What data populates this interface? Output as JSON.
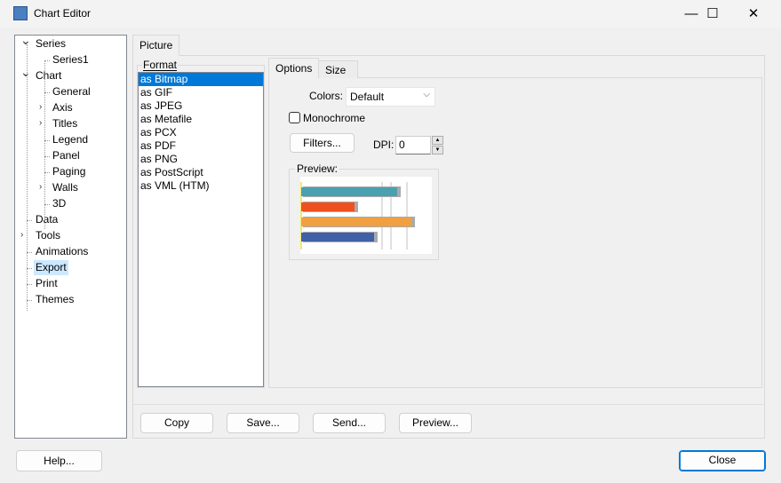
{
  "window": {
    "title": "Chart Editor",
    "minimize": "—",
    "maximize": "☐",
    "close": "✕"
  },
  "tree": [
    {
      "label": "Series",
      "expanded": true
    },
    {
      "label": "Series1"
    },
    {
      "label": "Chart",
      "expanded": true
    },
    {
      "label": "General"
    },
    {
      "label": "Axis",
      "collapsed": true
    },
    {
      "label": "Titles",
      "collapsed": true
    },
    {
      "label": "Legend"
    },
    {
      "label": "Panel"
    },
    {
      "label": "Paging"
    },
    {
      "label": "Walls",
      "collapsed": true
    },
    {
      "label": "3D"
    },
    {
      "label": "Data"
    },
    {
      "label": "Tools",
      "collapsed": true
    },
    {
      "label": "Animations"
    },
    {
      "label": "Export",
      "selected": true
    },
    {
      "label": "Print"
    },
    {
      "label": "Themes"
    }
  ],
  "tabs": {
    "picture": "Picture",
    "options": "Options",
    "size": "Size"
  },
  "format": {
    "label": "Format",
    "items": [
      "as Bitmap",
      "as GIF",
      "as JPEG",
      "as Metafile",
      "as PCX",
      "as PDF",
      "as PNG",
      "as PostScript",
      "as VML (HTM)"
    ],
    "selected": "as Bitmap"
  },
  "options": {
    "colors_label": "Colors:",
    "colors_value": "Default",
    "monochrome_label": "Monochrome",
    "monochrome_checked": false,
    "filters_button": "Filters...",
    "dpi_label": "DPI:",
    "dpi_value": "0",
    "preview_label": "Preview:"
  },
  "preview_colors": [
    "#4aa0b0",
    "#f05020",
    "#f0a040",
    "#4060a8"
  ],
  "buttons": {
    "copy": "Copy",
    "save": "Save...",
    "send": "Send...",
    "preview": "Preview...",
    "help": "Help...",
    "close": "Close"
  },
  "colors": {
    "accent": "#0078d7",
    "tree_selected": "#cce8ff"
  }
}
